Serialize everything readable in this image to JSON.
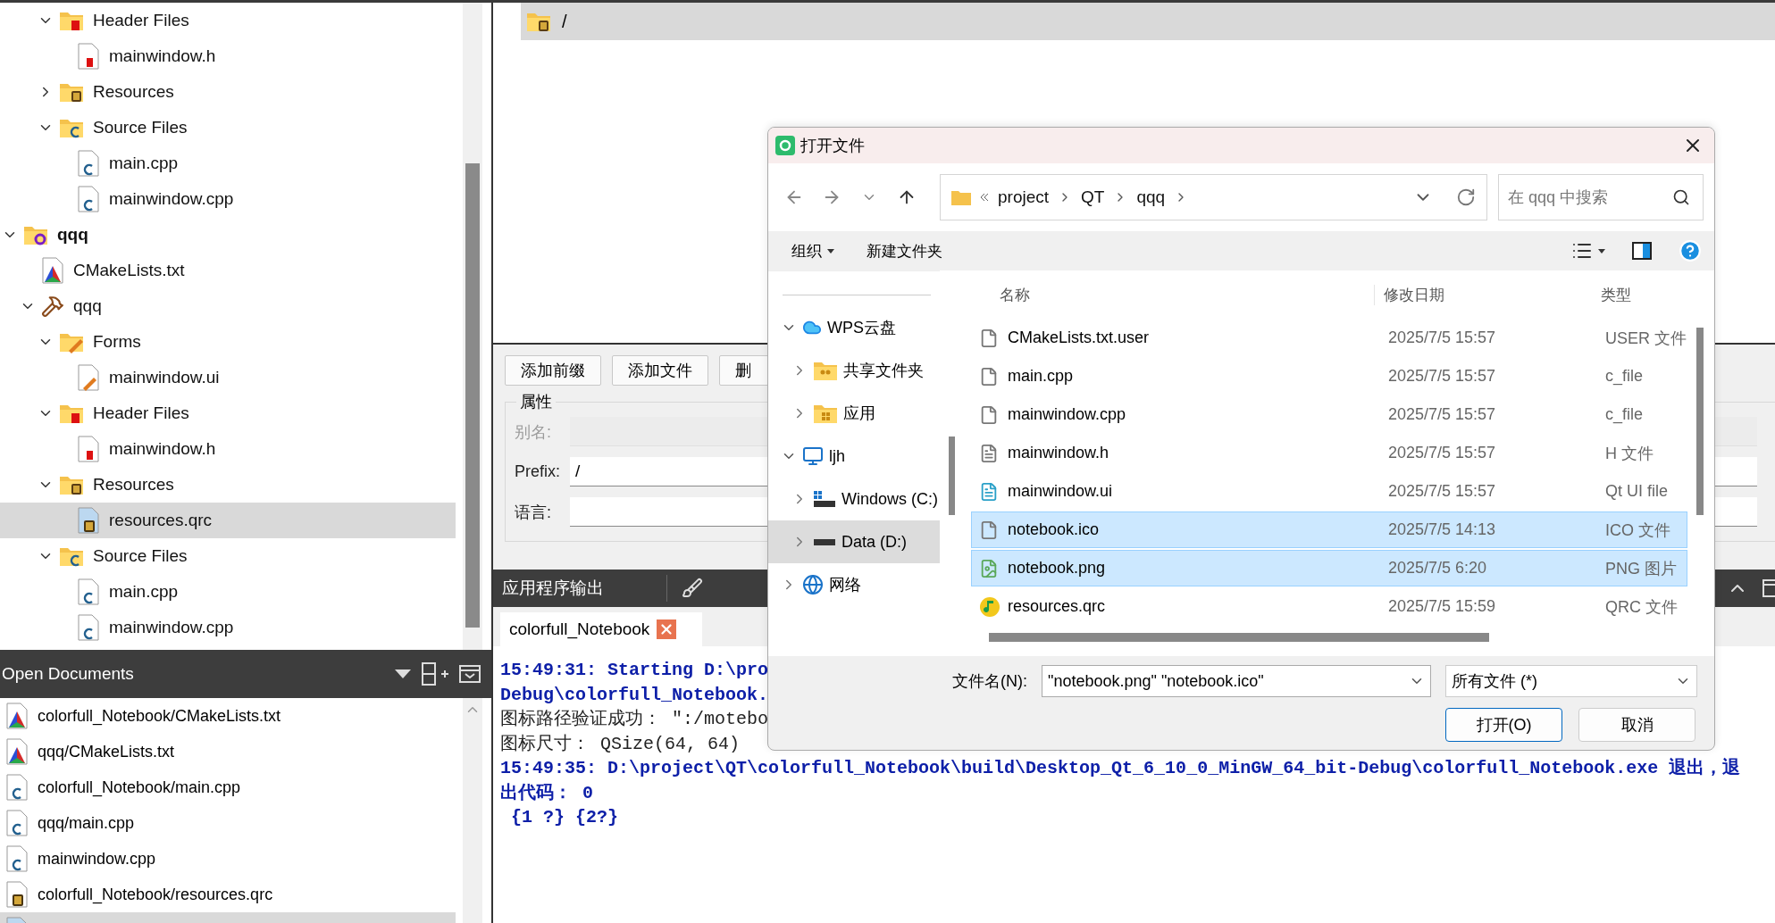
{
  "project_tree": [
    {
      "children": [
        {
          "children": [
            {
              "label": "Header Files",
              "kind": "folder-h",
              "expanded": true,
              "selected": false,
              "children": [
                {
                  "label": "mainwindow.h",
                  "kind": "file-h",
                  "selected": false
                }
              ]
            },
            {
              "label": "Resources",
              "kind": "folder-res",
              "expanded": false,
              "selected": false
            },
            {
              "label": "Source Files",
              "kind": "folder-cpp",
              "expanded": true,
              "selected": false,
              "children": [
                {
                  "label": "main.cpp",
                  "kind": "file-cpp",
                  "selected": false
                },
                {
                  "label": "mainwindow.cpp",
                  "kind": "file-cpp",
                  "selected": false
                }
              ]
            }
          ]
        }
      ]
    },
    {
      "label": "qqq",
      "kind": "project",
      "expanded": true,
      "selected": false,
      "children": [
        {
          "label": "CMakeLists.txt",
          "kind": "cmake",
          "selected": false
        },
        {
          "label": "qqq",
          "kind": "target",
          "expanded": true,
          "selected": false,
          "children": [
            {
              "label": "Forms",
              "kind": "folder-forms",
              "expanded": true,
              "selected": false,
              "children": [
                {
                  "label": "mainwindow.ui",
                  "kind": "file-ui",
                  "selected": false
                }
              ]
            },
            {
              "label": "Header Files",
              "kind": "folder-h",
              "expanded": true,
              "selected": false,
              "children": [
                {
                  "label": "mainwindow.h",
                  "kind": "file-h",
                  "selected": false
                }
              ]
            },
            {
              "label": "Resources",
              "kind": "folder-res",
              "expanded": true,
              "selected": false,
              "children": [
                {
                  "label": "resources.qrc",
                  "kind": "file-qrc",
                  "selected": true
                }
              ]
            },
            {
              "label": "Source Files",
              "kind": "folder-cpp",
              "expanded": true,
              "selected": false,
              "children": [
                {
                  "label": "main.cpp",
                  "kind": "file-cpp",
                  "selected": false
                },
                {
                  "label": "mainwindow.cpp",
                  "kind": "file-cpp",
                  "selected": false
                }
              ]
            }
          ]
        }
      ]
    }
  ],
  "open_documents": {
    "title": "Open Documents",
    "items": [
      {
        "label": "colorfull_Notebook/CMakeLists.txt",
        "kind": "cmake",
        "selected": false
      },
      {
        "label": "qqq/CMakeLists.txt",
        "kind": "cmake",
        "selected": false
      },
      {
        "label": "colorfull_Notebook/main.cpp",
        "kind": "file-cpp",
        "selected": false
      },
      {
        "label": "qqq/main.cpp",
        "kind": "file-cpp",
        "selected": false
      },
      {
        "label": "mainwindow.cpp",
        "kind": "file-cpp",
        "selected": false
      },
      {
        "label": "colorfull_Notebook/resources.qrc",
        "kind": "file-qrc",
        "selected": false
      },
      {
        "kind": "file-qrc",
        "selected": true
      }
    ]
  },
  "editor": {
    "prefix_path": "/"
  },
  "resource_panel": {
    "buttons": [
      "添加前缀",
      "添加文件",
      "删"
    ],
    "group_title": "属性",
    "fields": [
      {
        "label": "别名:",
        "disabled": true
      },
      {
        "label": "Prefix:",
        "value": "/",
        "disabled": false
      },
      {
        "label": "语言:",
        "disabled": false
      }
    ]
  },
  "output": {
    "title": "应用程序输出",
    "tab": "colorfull_Notebook",
    "lines": [
      {
        "text": "15:49:31: Starting D:\\pro",
        "kind": "status"
      },
      {
        "text": "Debug\\colorfull_Notebook.",
        "kind": "status"
      },
      {
        "text": "图标路径验证成功： \":/motebo",
        "kind": "log"
      },
      {
        "text": "图标尺寸： QSize(64, 64)",
        "kind": "log"
      },
      {
        "text": "15:49:35: D:\\project\\QT\\colorfull_Notebook\\build\\Desktop_Qt_6_10_0_MinGW_64_bit-Debug\\colorfull_Notebook.exe 退出，退",
        "kind": "status"
      },
      {
        "text": "出代码： 0",
        "kind": "status"
      },
      {
        "text": " {1 ?} {2?}",
        "kind": "status"
      }
    ]
  },
  "dialog": {
    "title": "打开文件",
    "breadcrumb": [
      "project",
      "QT",
      "qqq"
    ],
    "search": {
      "placeholder": "在 qqq 中搜索"
    },
    "toolbar": [
      "组织",
      "新建文件夹"
    ],
    "nav": [
      {
        "label": "WPS云盘",
        "kind": "cloud",
        "expanded": true,
        "selected": false,
        "children": [
          {
            "label": "共享文件夹",
            "kind": "shared",
            "expanded": false,
            "selected": false
          },
          {
            "label": "应用",
            "kind": "apps",
            "expanded": false,
            "selected": false
          }
        ]
      },
      {
        "label": "ljh",
        "kind": "pc",
        "expanded": true,
        "selected": false,
        "children": [
          {
            "label": "Windows (C:)",
            "kind": "windrive",
            "expanded": false,
            "selected": false
          },
          {
            "label": "Data (D:)",
            "kind": "drive",
            "expanded": false,
            "selected": true
          }
        ]
      },
      {
        "label": "网络",
        "kind": "network",
        "expanded": false,
        "selected": false
      }
    ],
    "columns": [
      "名称",
      "修改日期",
      "类型"
    ],
    "files": [
      {
        "name": "CMakeLists.txt.user",
        "date": "2025/7/5 15:57",
        "type": "USER 文件",
        "kind": "file",
        "selected": false
      },
      {
        "name": "main.cpp",
        "date": "2025/7/5 15:57",
        "type": "c_file",
        "kind": "file",
        "selected": false
      },
      {
        "name": "mainwindow.cpp",
        "date": "2025/7/5 15:57",
        "type": "c_file",
        "kind": "file",
        "selected": false
      },
      {
        "name": "mainwindow.h",
        "date": "2025/7/5 15:57",
        "type": "H 文件",
        "kind": "text",
        "selected": false
      },
      {
        "name": "mainwindow.ui",
        "date": "2025/7/5 15:57",
        "type": "Qt UI file",
        "kind": "ui",
        "selected": false
      },
      {
        "name": "notebook.ico",
        "date": "2025/7/5 14:13",
        "type": "ICO 文件",
        "kind": "file",
        "selected": true
      },
      {
        "name": "notebook.png",
        "date": "2025/7/5 6:20",
        "type": "PNG 图片",
        "kind": "image",
        "selected": true
      },
      {
        "name": "resources.qrc",
        "date": "2025/7/5 15:59",
        "type": "QRC 文件",
        "kind": "music",
        "selected": false
      }
    ],
    "filename_label": "文件名(N):",
    "filename_value": "\"notebook.png\" \"notebook.ico\"",
    "filter": "所有文件 (*)",
    "buttons": [
      {
        "label": "打开(O)",
        "primary": true
      },
      {
        "label": "取消",
        "primary": false
      }
    ]
  }
}
